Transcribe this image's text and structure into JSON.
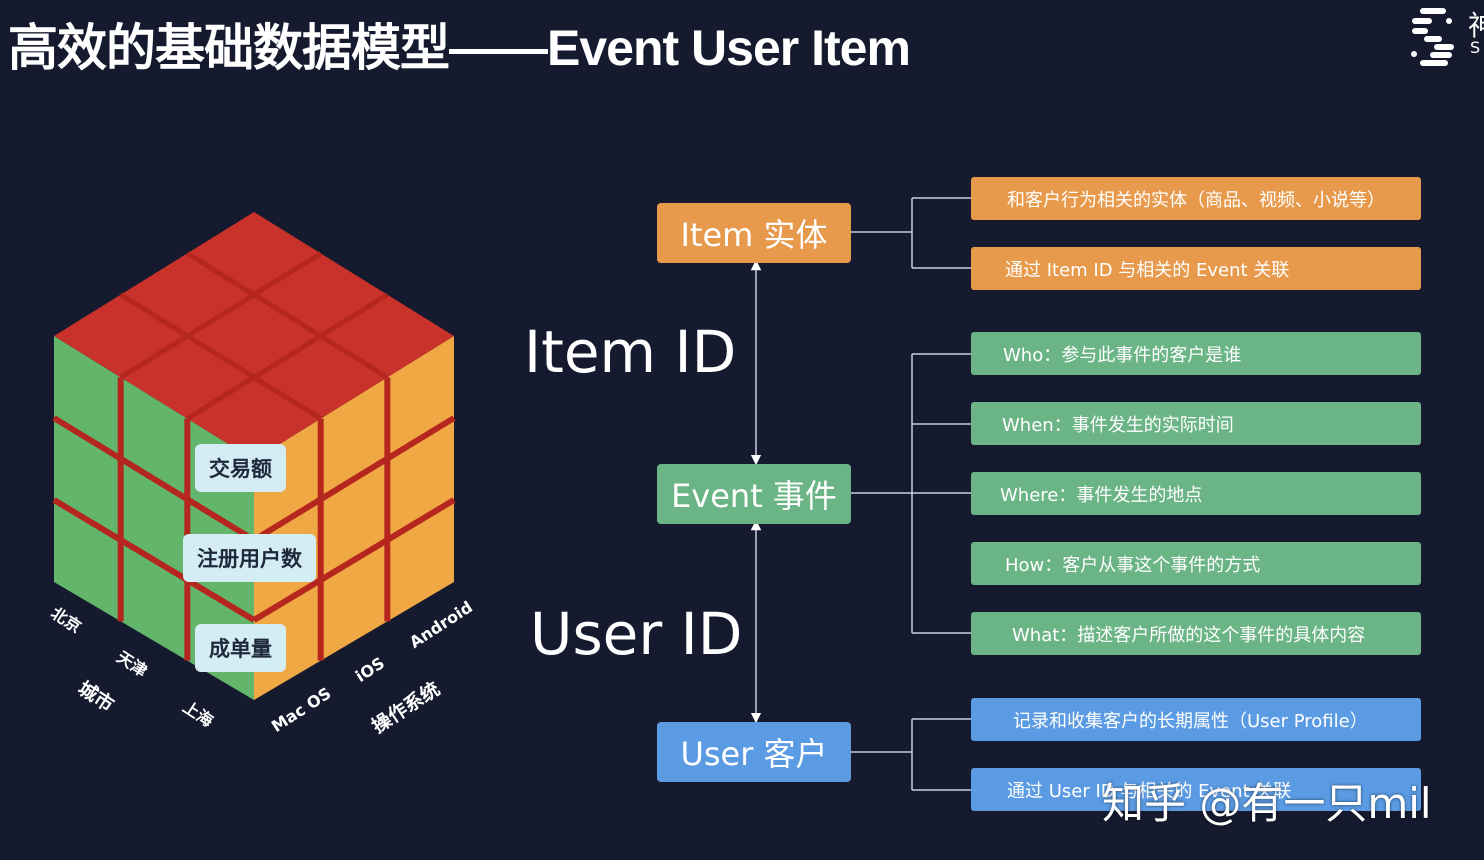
{
  "title": "高效的基础数据模型——Event User Item",
  "logo": {
    "char": "神",
    "sub": "S"
  },
  "cube": {
    "colors": {
      "top": "#c8322a",
      "left": "#62b56a",
      "right": "#f0a844",
      "grid": "#b5261f"
    },
    "metrics": [
      "交易额",
      "注册用户数",
      "成单量"
    ],
    "city_axis": {
      "title": "城市",
      "values": [
        "北京",
        "天津",
        "上海"
      ]
    },
    "os_axis": {
      "title": "操作系统",
      "values": [
        "Mac OS",
        "iOS",
        "Android"
      ]
    }
  },
  "ids": {
    "item": "Item ID",
    "user": "User ID"
  },
  "entities": {
    "item": {
      "label": "Item 实体",
      "color": "#e89a4c"
    },
    "event": {
      "label": "Event 事件",
      "color": "#6ab486"
    },
    "user": {
      "label": "User 客户",
      "color": "#5b9be3"
    }
  },
  "details": {
    "item": [
      "和客户行为相关的实体（商品、视频、小说等）",
      "通过 Item ID 与相关的 Event 关联"
    ],
    "event": [
      "Who：参与此事件的客户是谁",
      "When：事件发生的实际时间",
      "Where：事件发生的地点",
      "How：客户从事这个事件的方式",
      "What：描述客户所做的这个事件的具体内容"
    ],
    "user": [
      "记录和收集客户的长期属性（User Profile）",
      "通过 User ID 与相关的 Event 关联"
    ]
  },
  "watermark": "知乎 @有一只mil"
}
